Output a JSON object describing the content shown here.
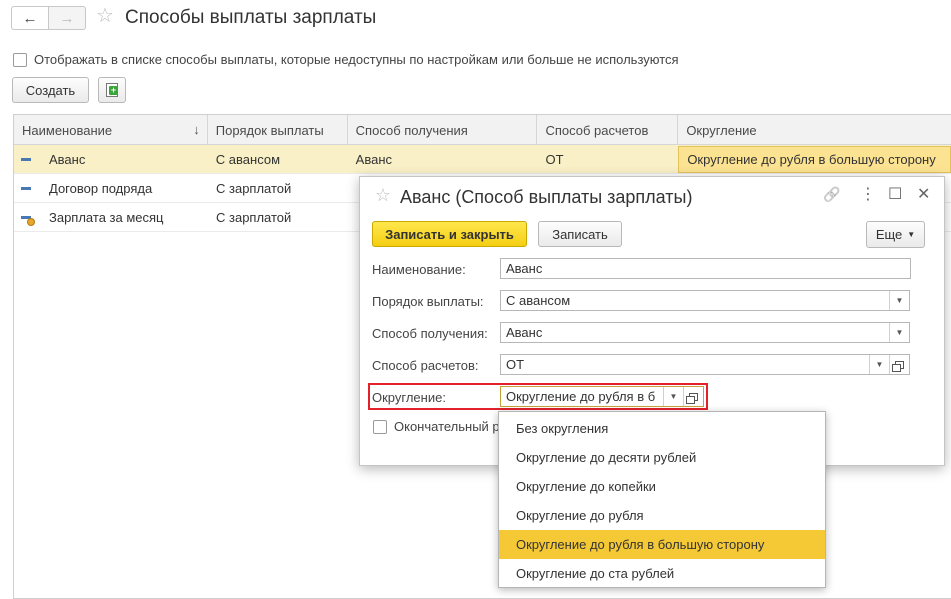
{
  "header": {
    "title": "Способы выплаты зарплаты",
    "back_glyph": "←",
    "forward_glyph": "→",
    "star_glyph": "☆"
  },
  "filter": {
    "show_all_label": "Отображать в списке способы выплаты, которые недоступны по настройкам или больше не используются",
    "checked": false
  },
  "toolbar": {
    "create_label": "Создать"
  },
  "grid": {
    "columns": [
      "Наименование",
      "Порядок выплаты",
      "Способ получения",
      "Способ расчетов",
      "Округление"
    ],
    "sort_glyph": "↓",
    "rows": [
      {
        "name": "Аванс",
        "order": "С авансом",
        "receipt": "Аванс",
        "calc": "ОТ",
        "rounding": "Округление до рубля в большую сторону"
      },
      {
        "name": "Договор подряда",
        "order": "С зарплатой",
        "receipt": "",
        "calc": "",
        "rounding": ""
      },
      {
        "name": "Зарплата за месяц",
        "order": "С зарплатой",
        "receipt": "",
        "calc": "",
        "rounding": ""
      }
    ]
  },
  "dialog": {
    "title": "Аванс (Способ выплаты зарплаты)",
    "star_glyph": "☆",
    "link_glyph": "🔗",
    "menu_glyph": "⋮",
    "maximize_glyph": "☐",
    "close_glyph": "✕",
    "save_close_label": "Записать и закрыть",
    "save_label": "Записать",
    "more_label": "Еще",
    "dd_glyph": "▼",
    "fields": {
      "name_label": "Наименование:",
      "name_value": "Аванс",
      "order_label": "Порядок выплаты:",
      "order_value": "С авансом",
      "receipt_label": "Способ получения:",
      "receipt_value": "Аванс",
      "calc_label": "Способ расчетов:",
      "calc_value": "ОТ",
      "rounding_label": "Округление:",
      "rounding_value": "Округление до рубля в б",
      "final_label": "Окончательный р"
    }
  },
  "dropdown": {
    "items": [
      "Без округления",
      "Округление до десяти рублей",
      "Округление до копейки",
      "Округление до рубля",
      "Округление до рубля в большую сторону",
      "Округление до ста рублей"
    ],
    "selected": "Округление до рубля в большую сторону"
  },
  "colors": {
    "accent_yellow": "#f4ce12",
    "selected_row": "#f9f0c7",
    "highlight_red": "#e2212b",
    "row_icon_blue": "#4a78b4"
  }
}
